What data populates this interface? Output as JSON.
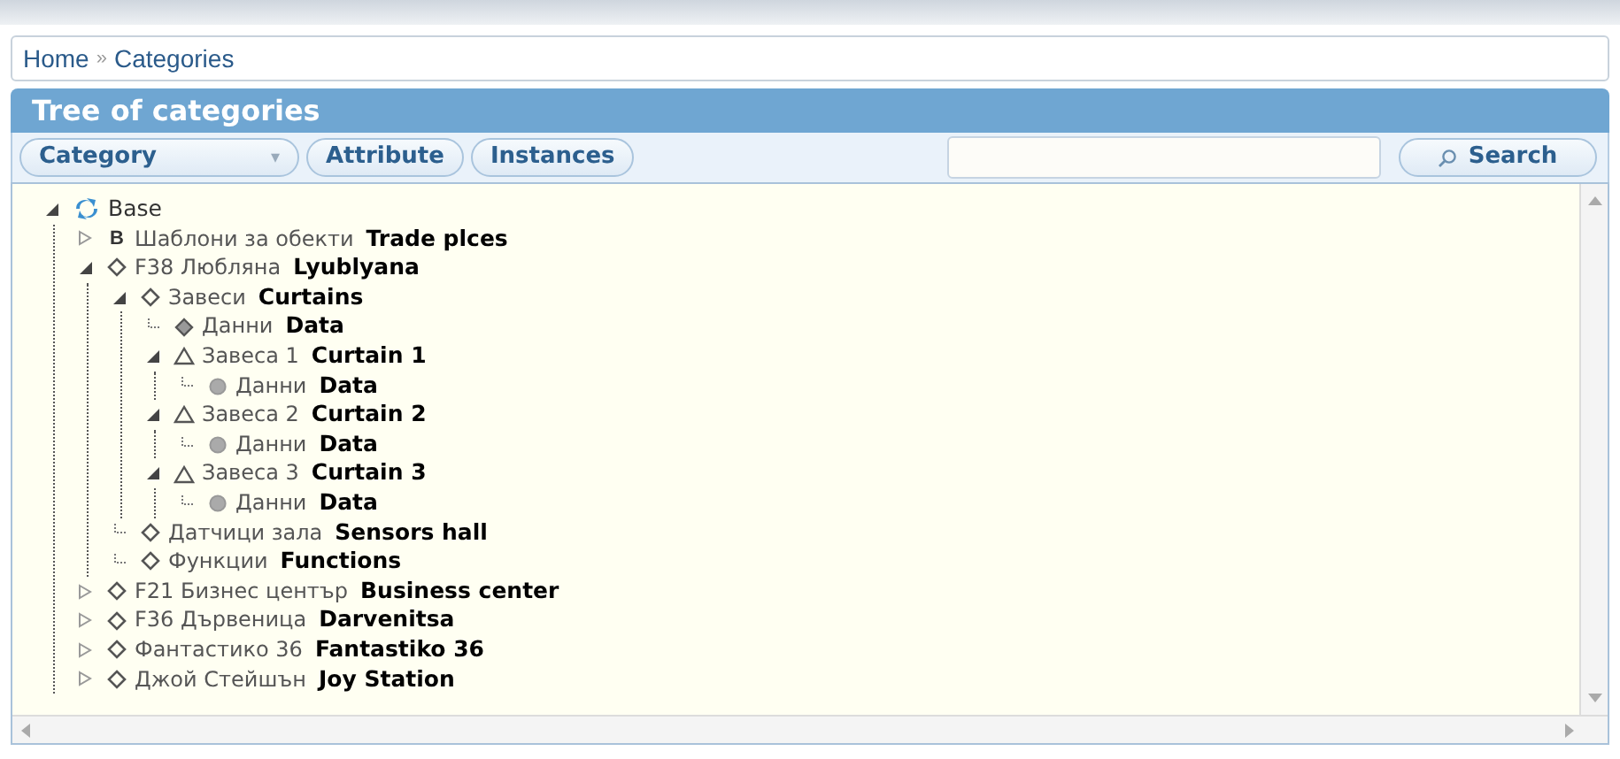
{
  "breadcrumb": {
    "items": [
      "Home",
      "Categories"
    ],
    "separator": "»"
  },
  "panel": {
    "title": "Tree of categories"
  },
  "toolbar": {
    "buttons": [
      {
        "label": "Category",
        "kind": "dropdown",
        "caret": "▾"
      },
      {
        "label": "Attribute",
        "kind": "plain"
      },
      {
        "label": "Instances",
        "kind": "plain"
      }
    ],
    "search_button": "Search"
  },
  "tree": [
    {
      "kind": "root",
      "name": "Base",
      "expanded": true,
      "children": [
        {
          "kind": "letter",
          "glyph": "B",
          "name": "Шаблони за обекти",
          "label": "Trade plces",
          "expanded": false
        },
        {
          "kind": "diamond",
          "name": "F38 Любляна",
          "label": "Lyublyana",
          "expanded": true,
          "children": [
            {
              "kind": "diamond",
              "name": "Завеси",
              "label": "Curtains",
              "expanded": true,
              "children": [
                {
                  "kind": "filled-diamond",
                  "name": "Данни",
                  "label": "Data"
                },
                {
                  "kind": "triangle",
                  "name": "Завеса 1",
                  "label": "Curtain 1",
                  "expanded": true,
                  "children": [
                    {
                      "kind": "circle",
                      "name": "Данни",
                      "label": "Data"
                    }
                  ]
                },
                {
                  "kind": "triangle",
                  "name": "Завеса 2",
                  "label": "Curtain 2",
                  "expanded": true,
                  "children": [
                    {
                      "kind": "circle",
                      "name": "Данни",
                      "label": "Data"
                    }
                  ]
                },
                {
                  "kind": "triangle",
                  "name": "Завеса 3",
                  "label": "Curtain 3",
                  "expanded": true,
                  "children": [
                    {
                      "kind": "circle",
                      "name": "Данни",
                      "label": "Data"
                    }
                  ]
                }
              ]
            },
            {
              "kind": "diamond",
              "name": "Датчици зала",
              "label": "Sensors hall"
            },
            {
              "kind": "diamond",
              "name": "Функции",
              "label": "Functions"
            }
          ]
        },
        {
          "kind": "diamond",
          "name": "F21 Бизнес център",
          "label": "Business center",
          "expanded": false
        },
        {
          "kind": "diamond",
          "name": "F36 Дървеница",
          "label": "Darvenitsa",
          "expanded": false
        },
        {
          "kind": "diamond",
          "name": "Фантастико 36",
          "label": "Fantastiko 36",
          "expanded": false
        },
        {
          "kind": "diamond",
          "name": "Джой Стейшън",
          "label": "Joy Station",
          "expanded": false
        }
      ]
    }
  ]
}
